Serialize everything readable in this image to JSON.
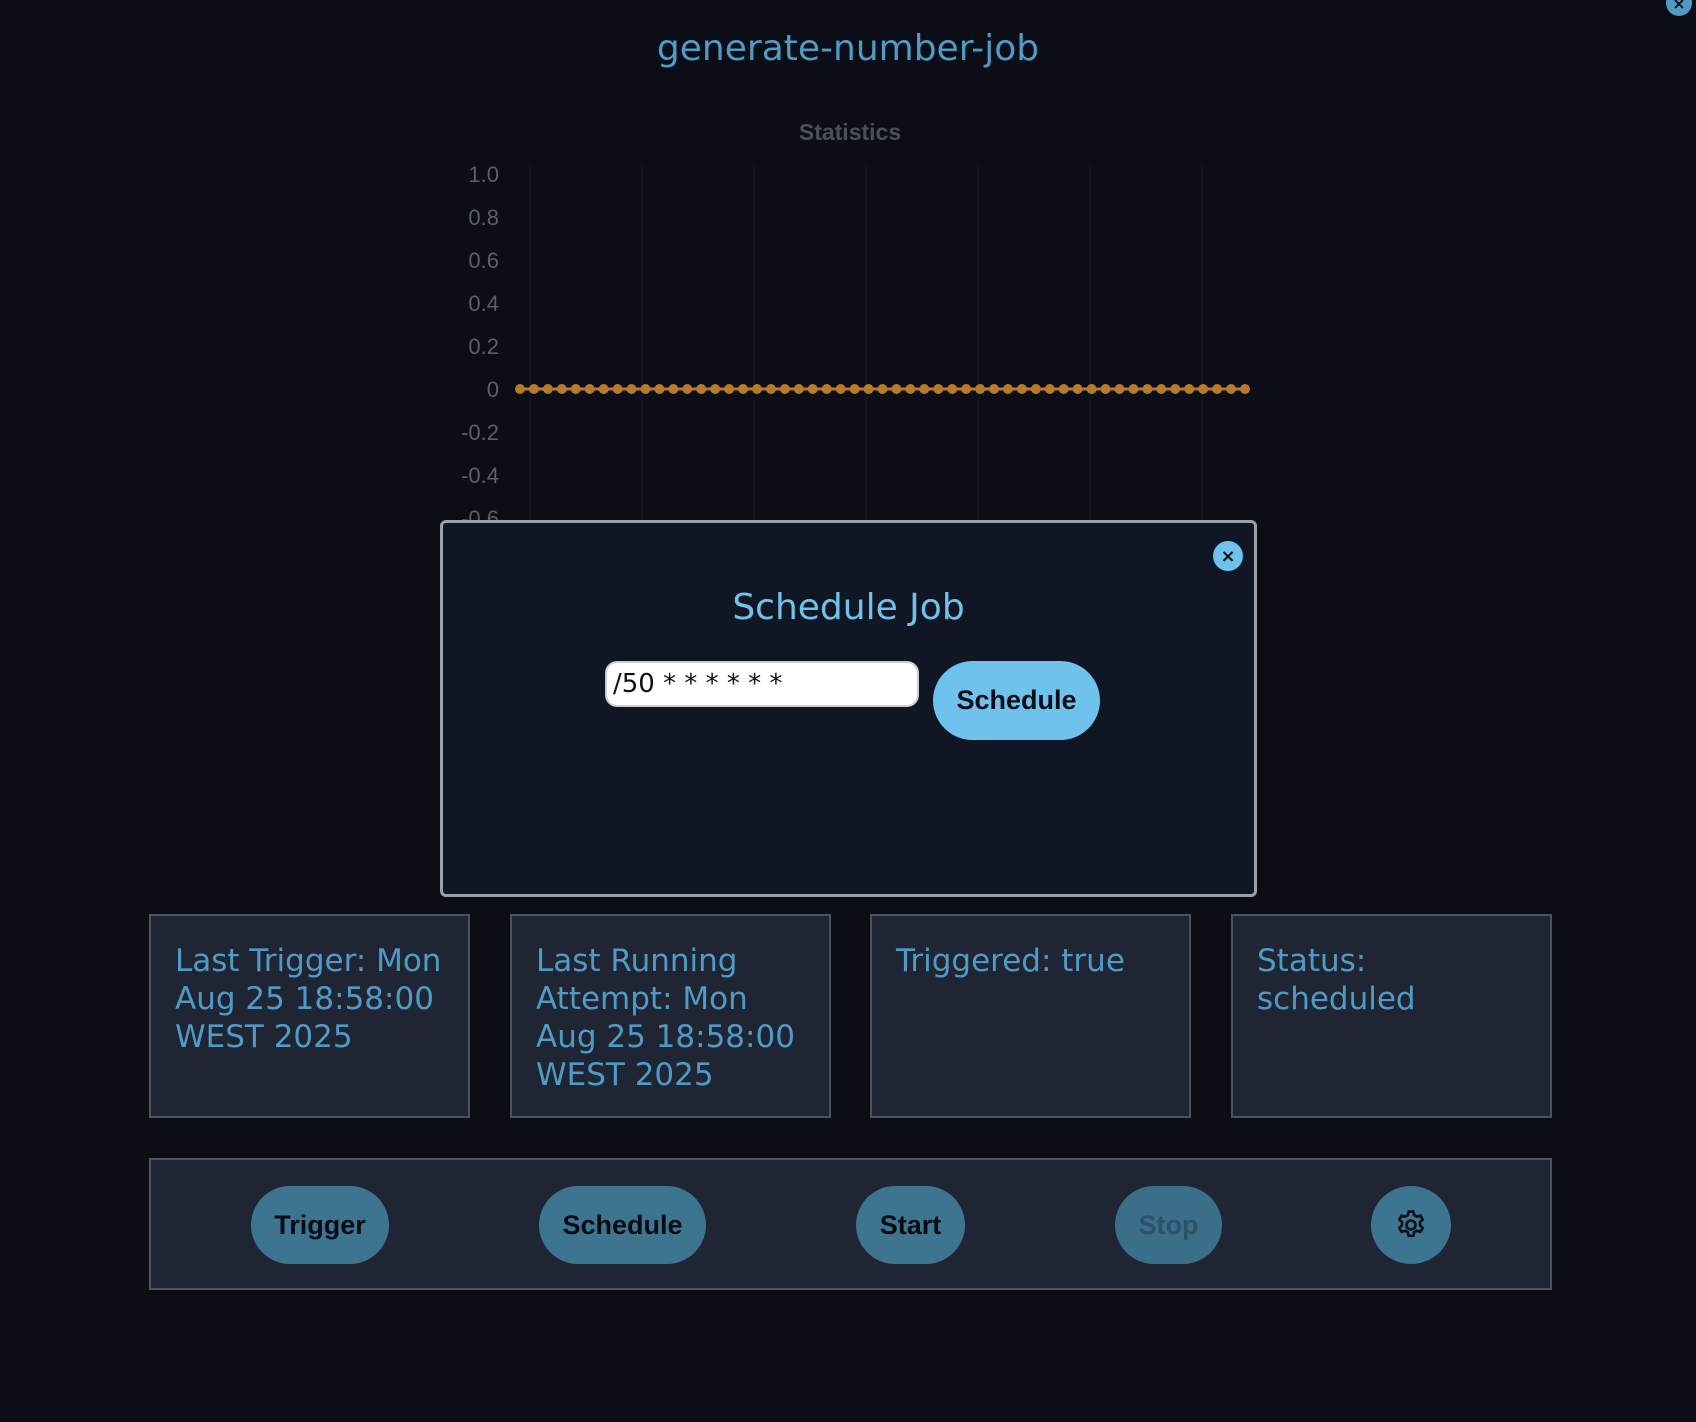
{
  "header": {
    "title": "generate-number-job",
    "close_symbol": "×"
  },
  "chart_data": {
    "type": "line",
    "title": "Statistics",
    "xlabel": "",
    "ylabel": "",
    "yticks": [
      "1.0",
      "0.8",
      "0.6",
      "0.4",
      "0.2",
      "0",
      "-0.2",
      "-0.4",
      "-0.6"
    ],
    "ylim": [
      -0.6,
      1.0
    ],
    "grid": true,
    "series": [
      {
        "values": [
          0,
          0,
          0,
          0,
          0,
          0,
          0,
          0,
          0,
          0,
          0,
          0,
          0,
          0,
          0,
          0,
          0,
          0,
          0,
          0,
          0,
          0,
          0,
          0,
          0,
          0,
          0,
          0,
          0,
          0,
          0,
          0,
          0,
          0,
          0,
          0,
          0,
          0,
          0,
          0,
          0,
          0,
          0,
          0,
          0,
          0,
          0,
          0,
          0,
          0,
          0,
          0,
          0
        ]
      }
    ],
    "colors": {
      "line": "#b97a2a",
      "axis_text": "#5a5f68",
      "grid": "#141824"
    }
  },
  "modal": {
    "title": "Schedule Job",
    "close_symbol": "×",
    "cron_value": "/50 * * * * * *",
    "schedule_label": "Schedule"
  },
  "info": {
    "last_trigger": "Last Trigger: Mon Aug 25 18:58:00 WEST 2025",
    "last_running_attempt": "Last Running Attempt: Mon Aug 25 18:58:00 WEST 2025",
    "triggered": "Triggered: true",
    "status": "Status: scheduled"
  },
  "actions": {
    "trigger_label": "Trigger",
    "schedule_label": "Schedule",
    "start_label": "Start",
    "stop_label": "Stop",
    "settings_icon": "gear-icon"
  },
  "colors": {
    "background": "#0b0e17",
    "accent": "#4f9bc5",
    "modal_accent": "#6fc2ec",
    "panel": "#1f2533",
    "button": "#3d7591"
  }
}
